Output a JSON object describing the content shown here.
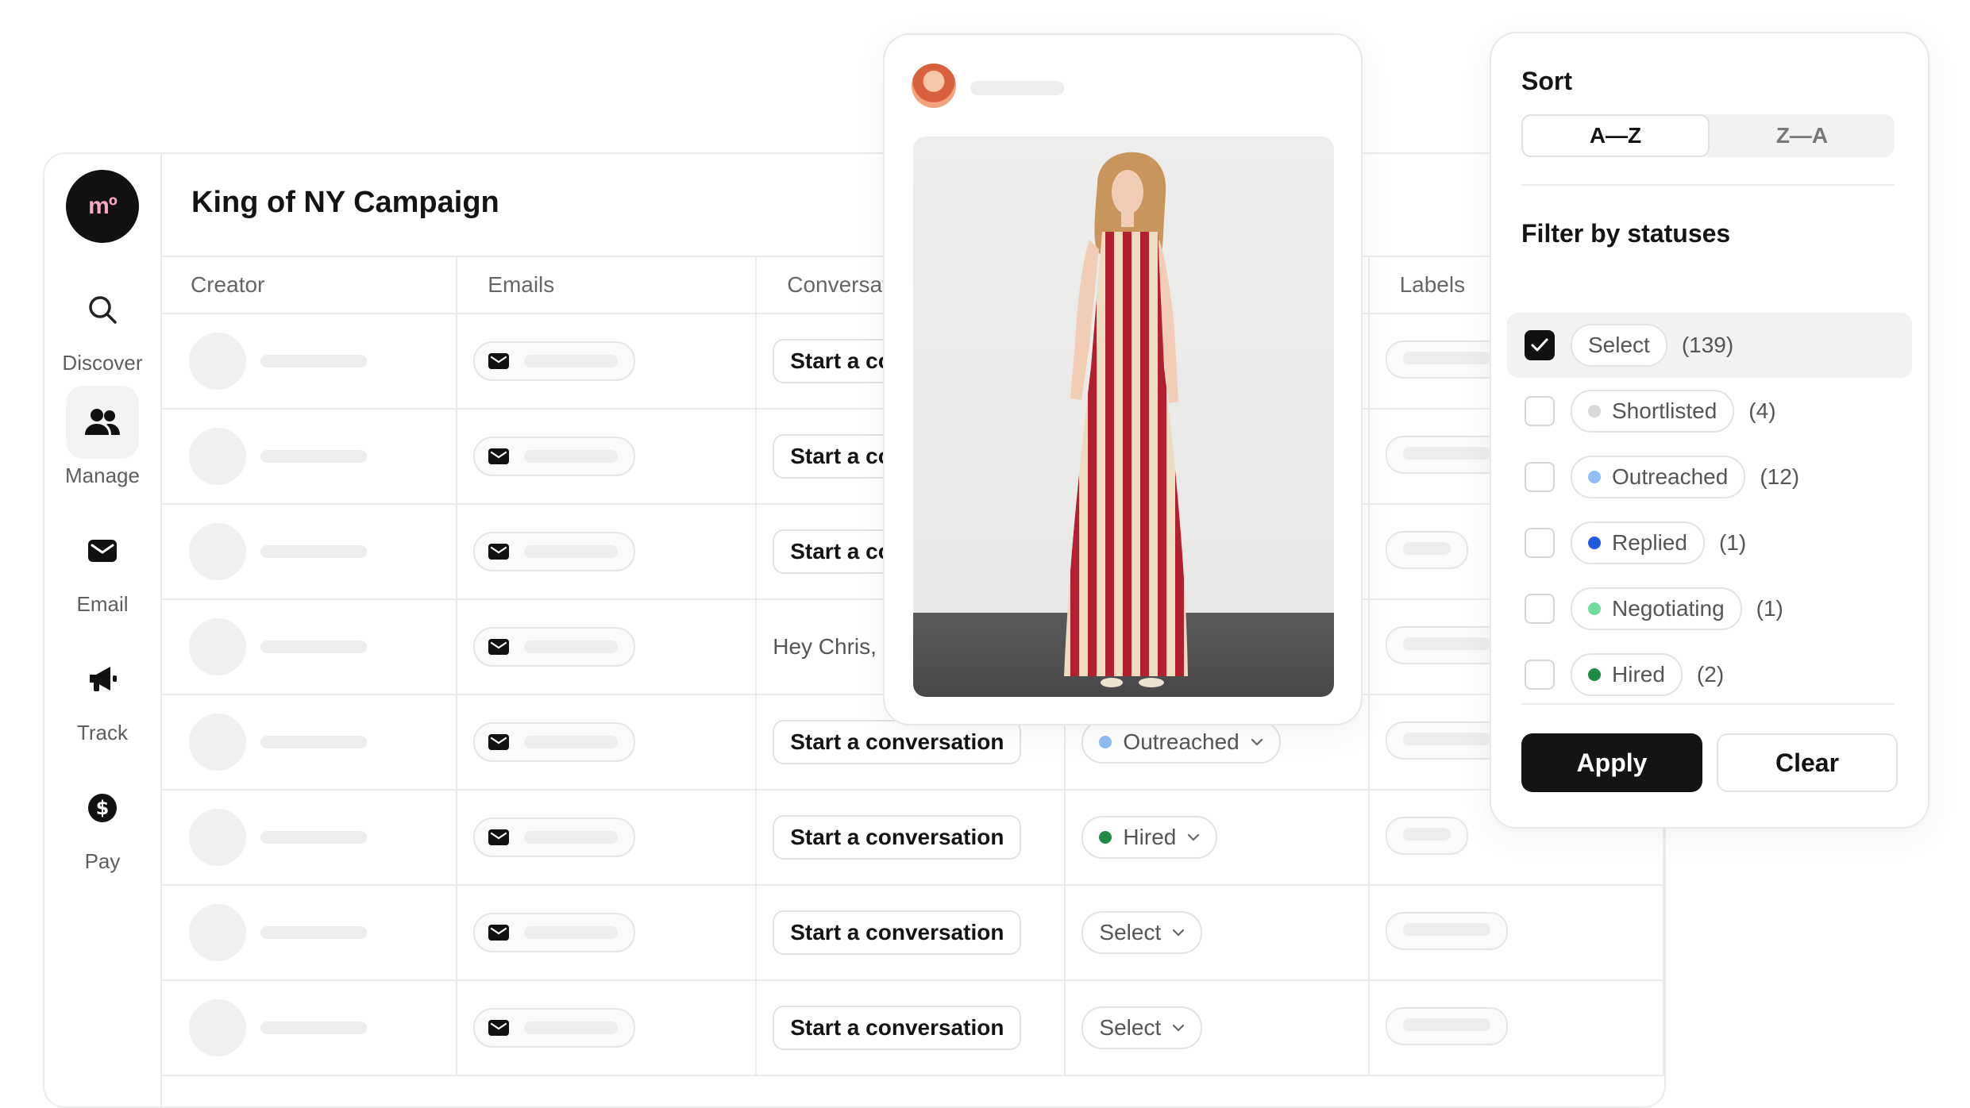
{
  "app": {
    "logo_text": "mº",
    "title": "King of NY Campaign"
  },
  "nav": [
    {
      "label": "Discover",
      "icon": "search-icon"
    },
    {
      "label": "Manage",
      "icon": "people-icon"
    },
    {
      "label": "Email",
      "icon": "mail-icon"
    },
    {
      "label": "Track",
      "icon": "megaphone-icon"
    },
    {
      "label": "Pay",
      "icon": "dollar-coin-icon"
    }
  ],
  "table": {
    "columns": [
      "Creator",
      "Emails",
      "Conversat",
      "",
      "Labels"
    ],
    "rows": [
      {
        "conversation": "Start a co",
        "status": "",
        "status_color": ""
      },
      {
        "conversation": "Start a co",
        "status": "",
        "status_color": ""
      },
      {
        "conversation": "Start a co",
        "status": "",
        "status_color": ""
      },
      {
        "conversation": "Hey Chris,",
        "status": "",
        "status_color": "",
        "is_message": true
      },
      {
        "conversation": "Start a conversation",
        "status": "Outreached",
        "status_color": "#8fbdf5"
      },
      {
        "conversation": "Start a conversation",
        "status": "Hired",
        "status_color": "#1e8a43"
      },
      {
        "conversation": "Start a conversation",
        "status": "Select",
        "status_color": ""
      },
      {
        "conversation": "Start a conversation",
        "status": "Select",
        "status_color": ""
      }
    ]
  },
  "panel": {
    "sort_title": "Sort",
    "sort_options": [
      "A—Z",
      "Z—A"
    ],
    "filter_title": "Filter by statuses",
    "statuses": [
      {
        "label": "Select",
        "count": "(139)",
        "checked": true,
        "color": ""
      },
      {
        "label": "Shortlisted",
        "count": "(4)",
        "checked": false,
        "color": "#d9d9d9"
      },
      {
        "label": "Outreached",
        "count": "(12)",
        "checked": false,
        "color": "#8fbdf5"
      },
      {
        "label": "Replied",
        "count": "(1)",
        "checked": false,
        "color": "#1f5ce0"
      },
      {
        "label": "Negotiating",
        "count": "(1)",
        "checked": false,
        "color": "#6fdc9a"
      },
      {
        "label": "Hired",
        "count": "(2)",
        "checked": false,
        "color": "#1e8a43"
      }
    ],
    "apply_label": "Apply",
    "clear_label": "Clear"
  }
}
